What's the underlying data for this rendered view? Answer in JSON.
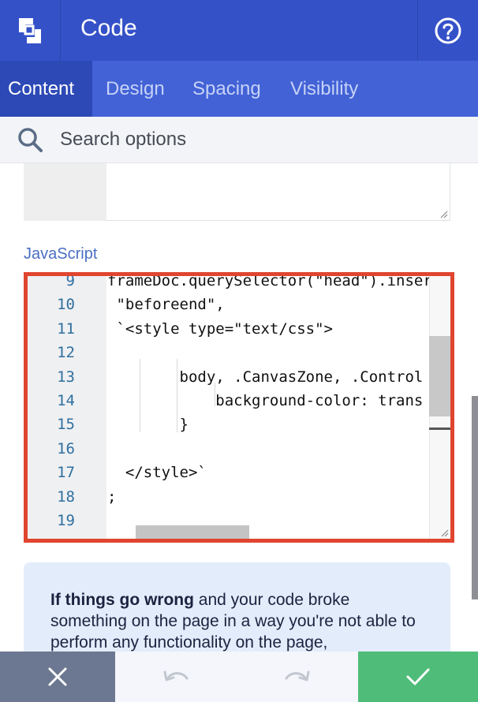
{
  "header": {
    "title": "Code",
    "logo_icon": "logo-icon",
    "help_icon": "help-icon"
  },
  "tabs": [
    {
      "label": "Content",
      "active": true
    },
    {
      "label": "Design",
      "active": false
    },
    {
      "label": "Spacing",
      "active": false
    },
    {
      "label": "Visibility",
      "active": false
    }
  ],
  "search": {
    "placeholder": "Search options",
    "icon": "search-icon"
  },
  "javascript": {
    "label": "JavaScript",
    "lines": [
      {
        "num": "9",
        "code": "frameDoc.querySelector(\"head\").inser"
      },
      {
        "num": "10",
        "code": " \"beforeend\","
      },
      {
        "num": "11",
        "code": " `<style type=\"text/css\">"
      },
      {
        "num": "12",
        "code": ""
      },
      {
        "num": "13",
        "code": "        body, .CanvasZone, .Control"
      },
      {
        "num": "14",
        "code": "            background-color: trans"
      },
      {
        "num": "15",
        "code": "        }"
      },
      {
        "num": "16",
        "code": ""
      },
      {
        "num": "17",
        "code": "  </style>`"
      },
      {
        "num": "18",
        "code": ";"
      },
      {
        "num": "19",
        "code": ""
      }
    ]
  },
  "info": {
    "bold": "If things go wrong",
    "text": " and your code broke something on the page in a way you're not able to perform any functionality on the page,"
  },
  "footer": {
    "cancel_icon": "close-icon",
    "undo_icon": "undo-icon",
    "redo_icon": "redo-icon",
    "confirm_icon": "check-icon"
  },
  "colors": {
    "header": "#3551c8",
    "tabs": "#4262d6",
    "active_tab": "#2c49b6",
    "highlight_border": "#e0452f",
    "confirm": "#4fbd79",
    "cancel": "#6c7891"
  }
}
